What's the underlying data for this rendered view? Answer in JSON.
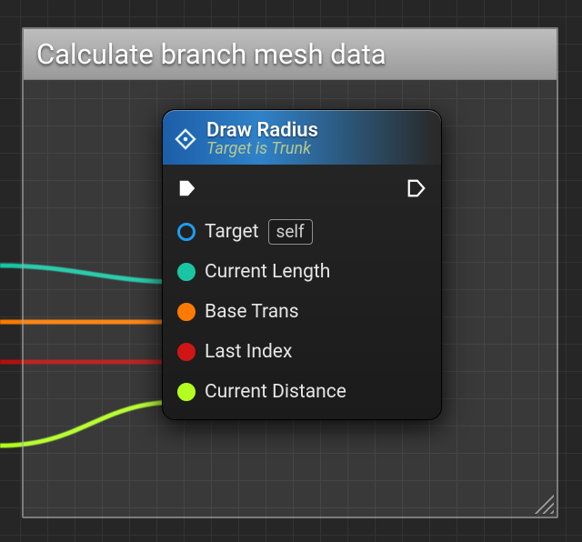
{
  "comment": {
    "title": "Calculate branch mesh data"
  },
  "node": {
    "title": "Draw Radius",
    "subtitle": "Target is Trunk",
    "pins": {
      "target": {
        "label": "Target",
        "default_box": "self"
      },
      "current_length": {
        "label": "Current Length"
      },
      "base_trans": {
        "label": "Base Trans"
      },
      "last_index": {
        "label": "Last Index"
      },
      "current_distance": {
        "label": "Current Distance"
      }
    }
  },
  "icons": {
    "function": "function-icon",
    "exec_in": "exec-in-pin-icon",
    "exec_out": "exec-out-pin-icon"
  },
  "wire_colors": {
    "current_length": "#18c6a4",
    "base_trans": "#ff7a00",
    "last_index": "#b31010",
    "current_distance": "#b3ff1f"
  }
}
